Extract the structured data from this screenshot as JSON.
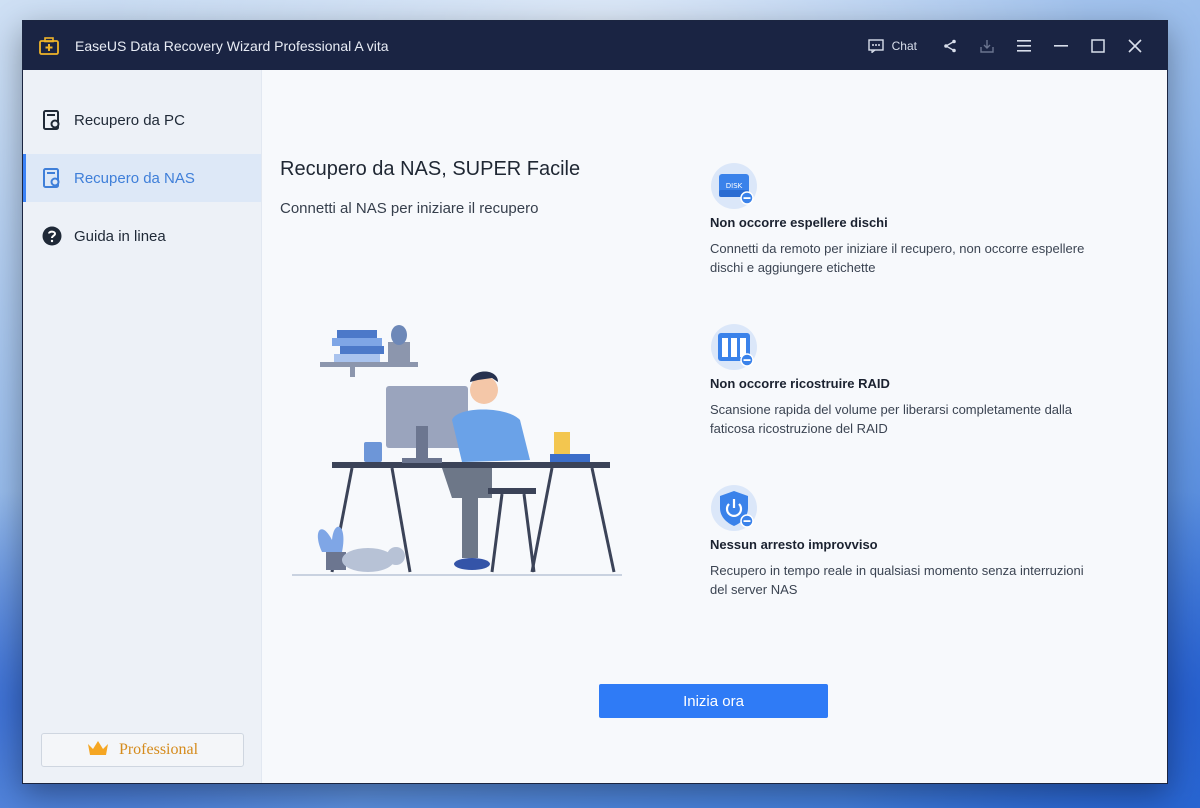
{
  "window": {
    "title": "EaseUS Data Recovery Wizard Professional A vita",
    "chat_label": "Chat"
  },
  "sidebar": {
    "items": [
      {
        "label": "Recupero da PC",
        "icon": "pc-recovery-icon",
        "active": false
      },
      {
        "label": "Recupero da NAS",
        "icon": "nas-recovery-icon",
        "active": true
      },
      {
        "label": "Guida in linea",
        "icon": "help-icon",
        "active": false
      }
    ],
    "badge_label": "Professional"
  },
  "main": {
    "title": "Recupero da NAS, SUPER Facile",
    "subtitle": "Connetti al NAS per iniziare il recupero",
    "features": [
      {
        "icon": "disk-icon",
        "icon_text": "DISK",
        "title": "Non occorre espellere dischi",
        "description": "Connetti da remoto per iniziare il recupero, non occorre espellere dischi e aggiungere etichette"
      },
      {
        "icon": "raid-icon",
        "title": "Non occorre ricostruire RAID",
        "description": "Scansione rapida del volume per liberarsi completamente dalla faticosa ricostruzione del RAID"
      },
      {
        "icon": "power-shield-icon",
        "title": "Nessun arresto improvviso",
        "description": "Recupero in tempo reale in qualsiasi momento senza interruzioni del server NAS"
      }
    ],
    "start_button": "Inizia ora"
  },
  "colors": {
    "titlebar": "#1a2443",
    "accent": "#2f7bf6",
    "active_nav_text": "#3f7fd9",
    "badge_text": "#d58b1c"
  }
}
